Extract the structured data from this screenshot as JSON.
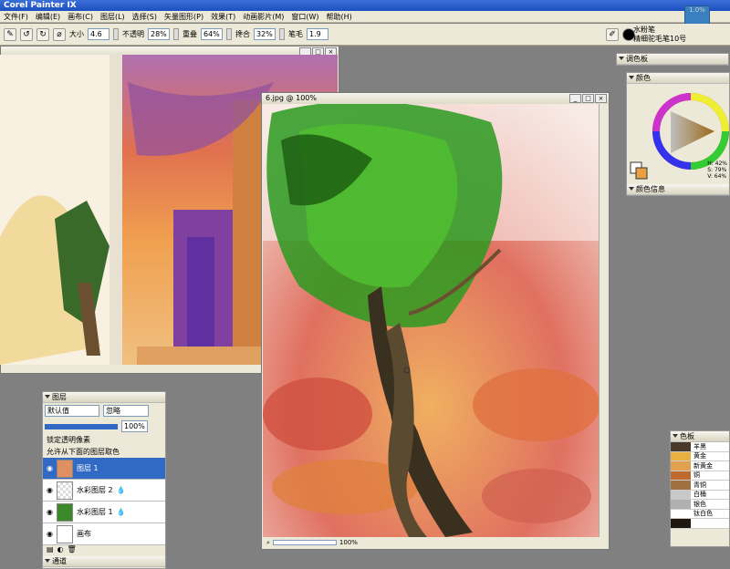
{
  "app": {
    "title": "Corel Painter IX"
  },
  "menu": [
    "文件(F)",
    "编辑(E)",
    "画布(C)",
    "图层(L)",
    "选择(S)",
    "矢量图形(P)",
    "效果(T)",
    "动画影片(M)",
    "窗口(W)",
    "帮助(H)"
  ],
  "props": {
    "size_label": "大小",
    "size": "4.6",
    "opacity_label": "不透明",
    "opacity": "28%",
    "resat_label": "重叠",
    "resat": "64%",
    "bleed_label": "搀合",
    "bleed": "32%",
    "jitter_label": "笔毛",
    "jitter": "1.9"
  },
  "brush": {
    "category": "水粉笔",
    "variant": "精细驼毛笔10号",
    "sample": "1.0%"
  },
  "main_window": {
    "title": "6.jpg @ 100%",
    "zoom": "100%"
  },
  "panels": {
    "mixer": "调色板",
    "color": "颜色",
    "color_info": "颜色信息",
    "hsv": [
      "H: 42%",
      "S: 79%",
      "V: 64%"
    ]
  },
  "layers": {
    "title": "图层",
    "composite": "默认值",
    "method": "忽略",
    "opacity": "100%",
    "options": [
      "锁定透明像素",
      "允许从下面的图层取色"
    ],
    "items": [
      "图层 1",
      "水彩图层 2",
      "水彩图层 1",
      "画布"
    ]
  },
  "channels": "通道",
  "swatches": {
    "title": "色板",
    "items": [
      {
        "name": "羊黑",
        "color": "#4a3a2a"
      },
      {
        "name": "黄金",
        "color": "#e8b040"
      },
      {
        "name": "新黄金",
        "color": "#e0a050"
      },
      {
        "name": "铜",
        "color": "#c06a30"
      },
      {
        "name": "青铜",
        "color": "#a07040"
      },
      {
        "name": "白桶",
        "color": "#c8c8c8"
      },
      {
        "name": "银色",
        "color": "#b0b0b0"
      },
      {
        "name": "钛白色",
        "color": "#ffffff"
      },
      {
        "name": "",
        "color": "#201810"
      }
    ]
  }
}
